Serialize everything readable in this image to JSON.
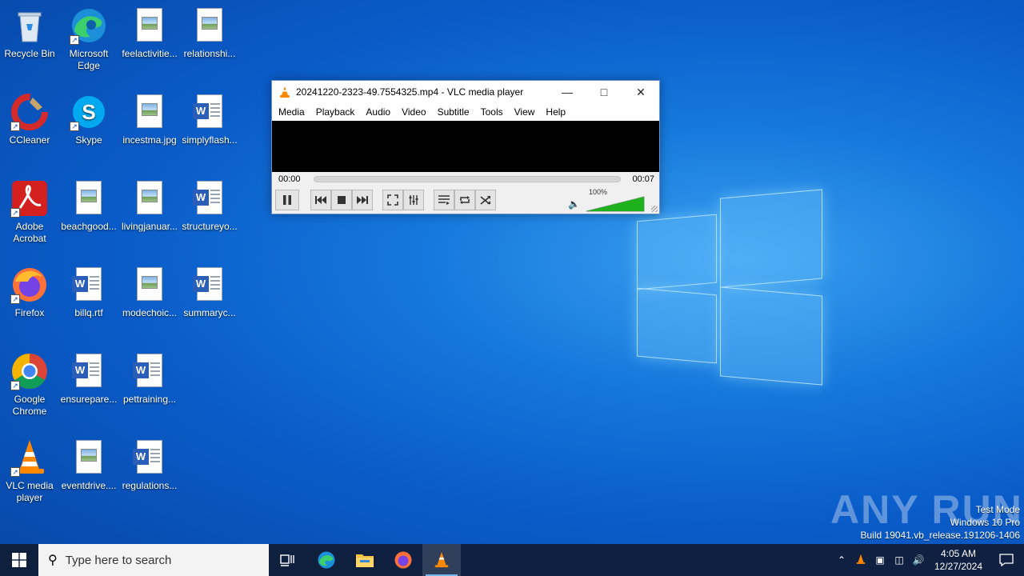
{
  "desktop": {
    "icons": [
      {
        "label": "Recycle Bin"
      },
      {
        "label": "Microsoft Edge"
      },
      {
        "label": "feelactivitie..."
      },
      {
        "label": "relationshi..."
      },
      {
        "label": "CCleaner"
      },
      {
        "label": "Skype"
      },
      {
        "label": "incestma.jpg"
      },
      {
        "label": "simplyflash..."
      },
      {
        "label": "Adobe Acrobat"
      },
      {
        "label": "beachgood..."
      },
      {
        "label": "livingjanuar..."
      },
      {
        "label": "structureyo..."
      },
      {
        "label": "Firefox"
      },
      {
        "label": "billq.rtf"
      },
      {
        "label": "modechoic..."
      },
      {
        "label": "summaryc..."
      },
      {
        "label": "Google Chrome"
      },
      {
        "label": "ensurepare..."
      },
      {
        "label": "pettraining..."
      },
      {
        "label": "VLC media player"
      },
      {
        "label": "eventdrive...."
      },
      {
        "label": "regulations..."
      }
    ]
  },
  "vlc": {
    "title": "20241220-2323-49.7554325.mp4 - VLC media player",
    "menu": [
      "Media",
      "Playback",
      "Audio",
      "Video",
      "Subtitle",
      "Tools",
      "View",
      "Help"
    ],
    "time_elapsed": "00:00",
    "time_total": "00:07",
    "playback_progress": 0.0,
    "volume_label": "100%",
    "volume_level": 1.0,
    "accent": "#1db21d"
  },
  "watermark": {
    "text": "ANY RUN",
    "line1": "Test Mode",
    "line2": "Windows 10 Pro",
    "line3": "Build 19041.vb_release.191206-1406"
  },
  "taskbar": {
    "search_placeholder": "Type here to search",
    "time": "4:05 AM",
    "date": "12/27/2024",
    "color": "#101e3a"
  }
}
